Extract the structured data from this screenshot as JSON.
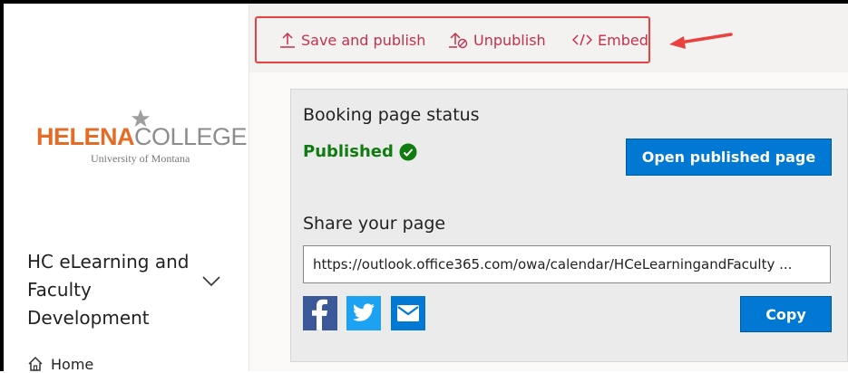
{
  "toolbar": {
    "save_publish_label": "Save and publish",
    "unpublish_label": "Unpublish",
    "embed_label": "Embed",
    "icons": [
      "upload-icon",
      "unpublish-icon",
      "code-icon"
    ]
  },
  "sidebar": {
    "logo": {
      "name_part1": "HELENA",
      "name_part2": "COLLEGE",
      "subtitle": "University of Montana"
    },
    "org_name": "HC eLearning and Faculty Development",
    "nav_items": [
      {
        "label": "Home",
        "icon": "home-icon"
      }
    ]
  },
  "status": {
    "title": "Booking page status",
    "state": "Published",
    "open_button": "Open published page"
  },
  "share": {
    "title": "Share your page",
    "url": "https://outlook.office365.com/owa/calendar/HCeLearningandFaculty ...",
    "copy_button": "Copy",
    "social_icons": [
      "facebook-icon",
      "twitter-icon",
      "mail-icon"
    ]
  },
  "colors": {
    "accent_blue": "#0078d4",
    "toolbar_text": "#c4314b",
    "published_green": "#107c10",
    "annotation_red": "#e8413f",
    "logo_orange": "#e46c27"
  }
}
